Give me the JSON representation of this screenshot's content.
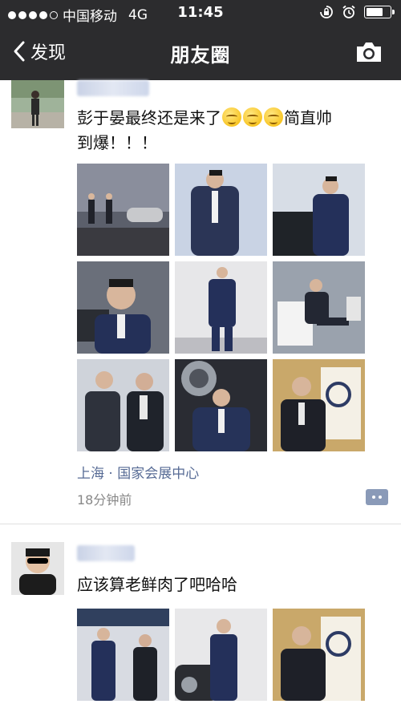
{
  "status_bar": {
    "carrier": "中国移动",
    "network": "4G",
    "time": "11:45",
    "battery_level": 0.75
  },
  "nav": {
    "back_label": "发现",
    "title": "朋友圈",
    "camera_icon": "camera-icon"
  },
  "posts": [
    {
      "text_line1": "彭于晏最终还是来了",
      "text_after_emoji": "简直帅",
      "text_line2": "到爆！！！",
      "emoji_count": 3,
      "location": "上海 · 国家会展中心",
      "time": "18分钟前",
      "photos": 9
    },
    {
      "text": "应该算老鲜肉了吧哈哈",
      "photos": 3
    }
  ],
  "colors": {
    "topbar": "#2c2c2e",
    "link_blue": "#576b95",
    "meta_gray": "#888888"
  }
}
